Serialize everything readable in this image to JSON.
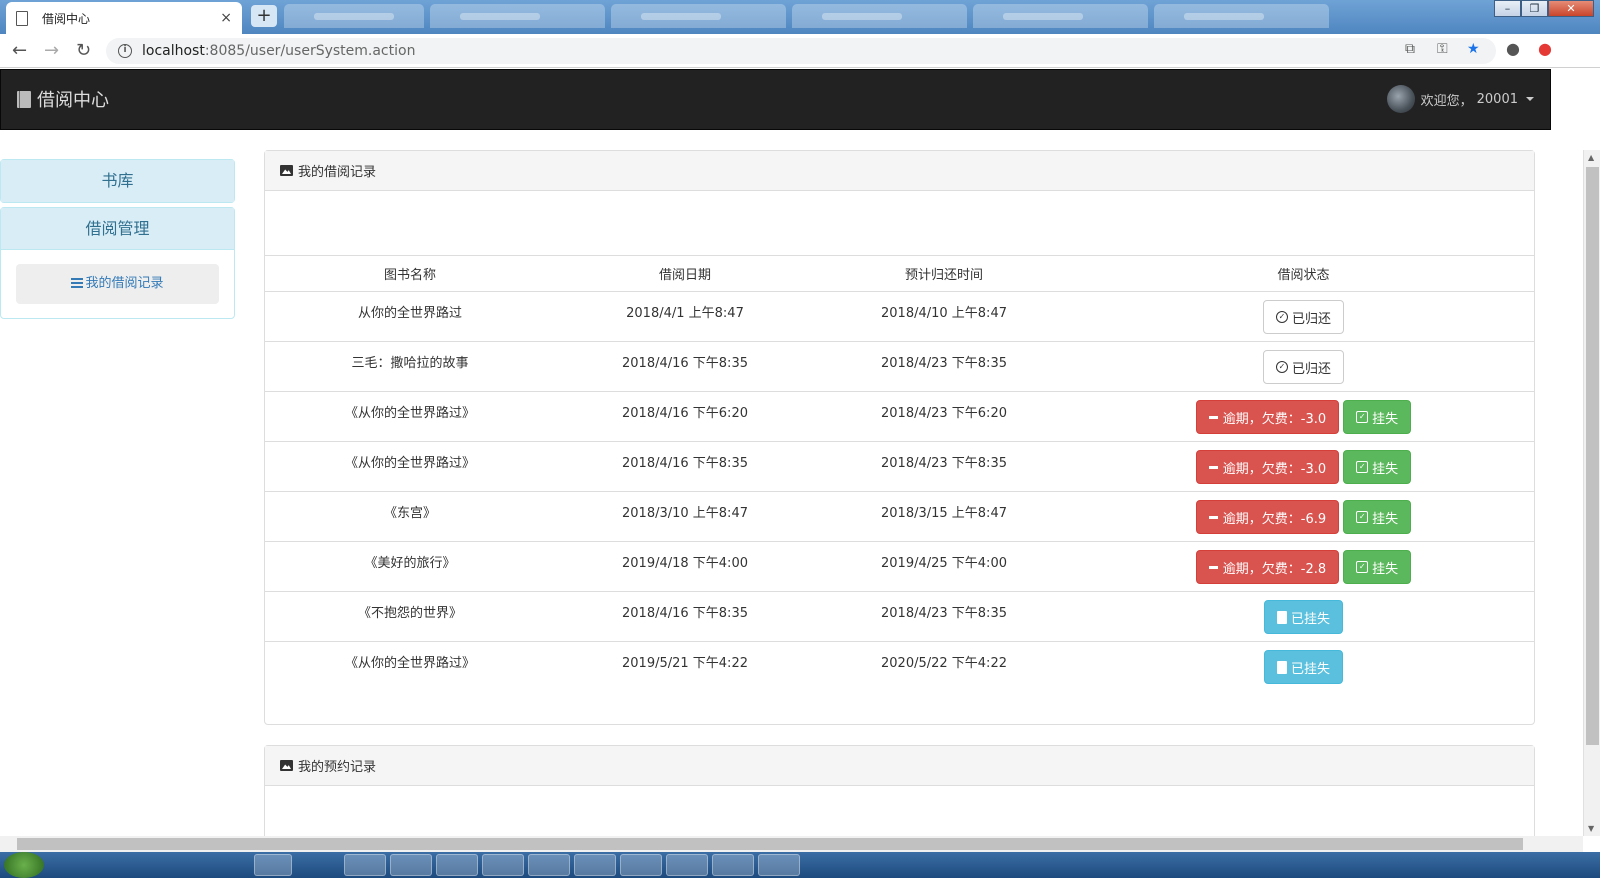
{
  "browser": {
    "tab_title": "借阅中心",
    "tab_close": "×",
    "new_tab": "+",
    "url_host": "localhost",
    "url_path": ":8085/user/userSystem.action"
  },
  "navbar": {
    "brand": "借阅中心",
    "welcome": "欢迎您，",
    "user_id": "20001"
  },
  "sidebar": {
    "library": "书库",
    "borrow_mgmt": "借阅管理",
    "my_records": "我的借阅记录"
  },
  "borrow_panel": {
    "title": "我的借阅记录",
    "headers": [
      "图书名称",
      "借阅日期",
      "预计归还时间",
      "借阅状态"
    ],
    "rows": [
      {
        "book": "从你的全世界路过",
        "borrow_date": "2018/4/1 上午8:47",
        "due_date": "2018/4/10 上午8:47",
        "status": "returned",
        "label": "已归还"
      },
      {
        "book": "三毛：撒哈拉的故事",
        "borrow_date": "2018/4/16 下午8:35",
        "due_date": "2018/4/23 下午8:35",
        "status": "returned",
        "label": "已归还"
      },
      {
        "book": "《从你的全世界路过》",
        "borrow_date": "2018/4/16 下午6:20",
        "due_date": "2018/4/23 下午6:20",
        "status": "overdue",
        "label": "逾期，欠费：-3.0",
        "action": "挂失"
      },
      {
        "book": "《从你的全世界路过》",
        "borrow_date": "2018/4/16 下午8:35",
        "due_date": "2018/4/23 下午8:35",
        "status": "overdue",
        "label": "逾期，欠费：-3.0",
        "action": "挂失"
      },
      {
        "book": "《东宫》",
        "borrow_date": "2018/3/10 上午8:47",
        "due_date": "2018/3/15 上午8:47",
        "status": "overdue",
        "label": "逾期，欠费：-6.9",
        "action": "挂失"
      },
      {
        "book": "《美好的旅行》",
        "borrow_date": "2019/4/18 下午4:00",
        "due_date": "2019/4/25 下午4:00",
        "status": "overdue",
        "label": "逾期，欠费：-2.8",
        "action": "挂失"
      },
      {
        "book": "《不抱怨的世界》",
        "borrow_date": "2018/4/16 下午8:35",
        "due_date": "2018/4/23 下午8:35",
        "status": "lost",
        "label": "已挂失"
      },
      {
        "book": "《从你的全世界路过》",
        "borrow_date": "2019/5/21 下午4:22",
        "due_date": "2020/5/22 下午4:22",
        "status": "lost",
        "label": "已挂失"
      }
    ]
  },
  "reserve_panel": {
    "title": "我的预约记录"
  },
  "colors": {
    "navbar_bg": "#222222",
    "side_head_bg": "#d9edf7",
    "danger": "#d9534f",
    "success": "#5cb85c",
    "info": "#5bc0de"
  }
}
